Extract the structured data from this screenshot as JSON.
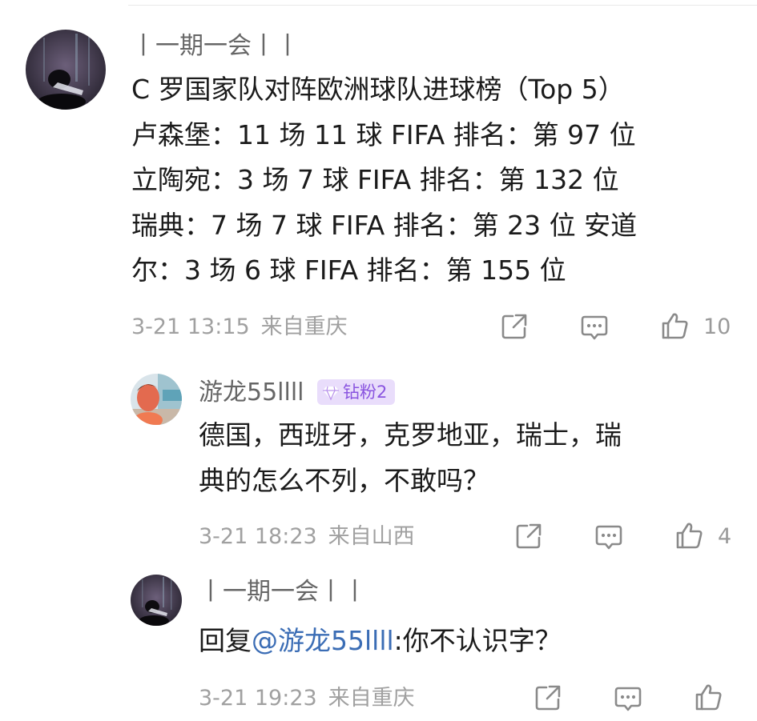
{
  "comment": {
    "username": "丨一期一会丨丨",
    "lines": [
      "C 罗国家队对阵欧洲球队进球榜（Top 5）",
      "卢森堡：11 场 11 球 FIFA 排名：第 97 位",
      "立陶宛：3 场 7 球 FIFA 排名：第 132 位",
      "瑞典：7 场 7 球 FIFA 排名：第 23 位 安道",
      "尔：3 场 6 球 FIFA 排名：第 155 位"
    ],
    "time": "3-21 13:15",
    "location": "来自重庆",
    "like_count": "10"
  },
  "reply1": {
    "username": "游龙55llll",
    "badge": "钻粉2",
    "lines": [
      "德国，西班牙，克罗地亚，瑞士，瑞",
      "典的怎么不列，不敢吗？"
    ],
    "time": "3-21 18:23",
    "location": "来自山西",
    "like_count": "4"
  },
  "reply2": {
    "username": "丨一期一会丨丨",
    "reply_prefix": "回复",
    "mention": "@游龙55llll",
    "reply_text": ":你不认识字？",
    "time": "3-21 19:23",
    "location": "来自重庆"
  },
  "icons": {
    "share": "share-icon",
    "comment": "comment-icon",
    "like": "thumbs-up-icon",
    "badge": "diamond-icon"
  },
  "colors": {
    "username": "#666666",
    "meta": "#a0a0a0",
    "mention": "#3b6db5",
    "badge_bg": "#e9ddfb",
    "badge_text": "#8a55e0"
  }
}
